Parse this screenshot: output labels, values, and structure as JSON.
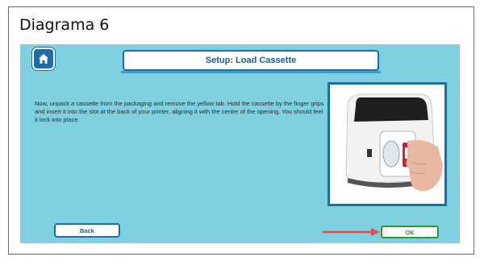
{
  "caption": "Diagrama 6",
  "header": {
    "title": "Setup: Load Cassette",
    "home_icon": "home-icon"
  },
  "main": {
    "instructions": "Now, unpack a cassette from the packaging and remove the yellow tab. Hold the cassette by the finger grips and insert it into the slot at the back of your printer, aligning it with the center of the opening. You should feel it lock into place."
  },
  "footer": {
    "back_label": "Back",
    "ok_label": "OK"
  },
  "colors": {
    "screen_background": "#7fd0e0",
    "accent_blue": "#1b6fa8",
    "ok_green": "#2c9a2c",
    "annotation_arrow": "#d9534f"
  }
}
